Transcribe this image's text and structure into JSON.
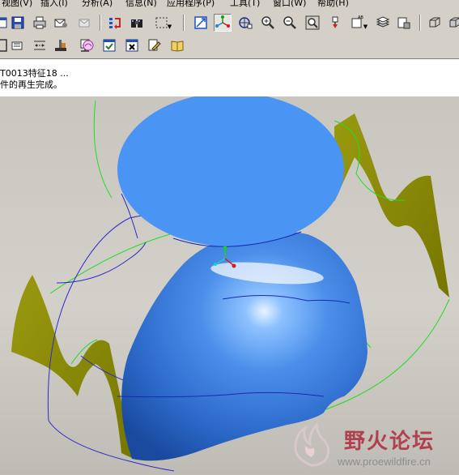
{
  "menubar": {
    "items": [
      "视图(V)",
      "插入(I)",
      "分析(A)",
      "信息(N)",
      "应用程序(P)",
      "工具(T)",
      "窗口(W)",
      "帮助(H)"
    ]
  },
  "toolbar_top": {
    "icons": [
      "window-fragment-icon",
      "save-icon",
      "print-icon",
      "send-mail-icon",
      "send-mail-disabled-icon",
      "regenerate-icon",
      "find-binoculars-icon",
      "selection-box-icon",
      "sketch-view-icon",
      "spin-center-icon",
      "saved-views-icon",
      "zoom-in-icon",
      "zoom-out-icon",
      "refit-icon",
      "reorient-icon",
      "view-manager-icon",
      "layers-icon",
      "model-display-icon",
      "wireframe-cube-icon",
      "shaded-cube-icon"
    ]
  },
  "toolbar_bottom": {
    "icons": [
      "datum-fragment-icon",
      "datum-plane-icon",
      "datum-axis-icon",
      "datum-point-icon",
      "coordinate-system-icon",
      "appearance-icon",
      "window-check-icon",
      "close-window-icon",
      "edit-pencil-icon",
      "book-icon"
    ]
  },
  "messages": {
    "line1": "T0013特征18 ...",
    "line2": "件的再生完成。"
  },
  "viewport": {
    "colors": {
      "surface_blue": "#4a94f4",
      "olive_surface": "#8a8a00",
      "curve_green": "#22dd22",
      "curve_blue": "#2c2ccc"
    }
  },
  "watermark": {
    "title": "野火论坛",
    "url": "www.proewildfire.cn"
  }
}
